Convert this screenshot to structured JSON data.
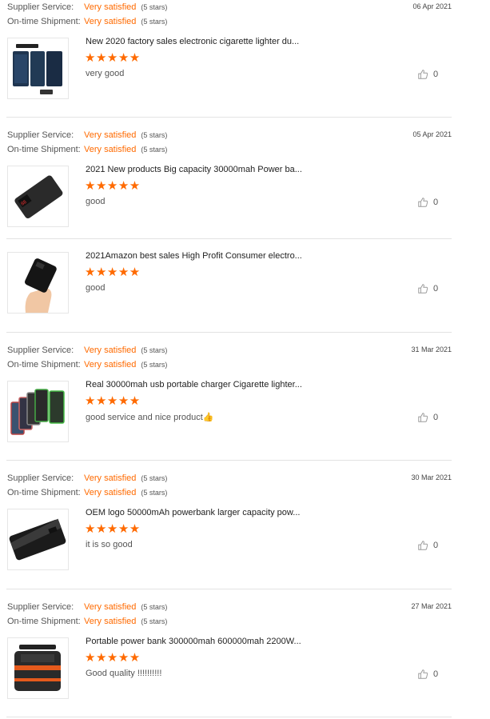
{
  "labels": {
    "supplier_service": "Supplier Service:",
    "on_time_shipment": "On-time Shipment:"
  },
  "reviews": [
    {
      "supplier_rating": "Very satisfied",
      "supplier_stars": "(5 stars)",
      "shipment_rating": "Very satisfied",
      "shipment_stars": "(5 stars)",
      "date": "06 Apr 2021",
      "items": [
        {
          "product": "New 2020 factory sales electronic cigarette lighter du...",
          "rating": 5,
          "comment": "very good",
          "likes": "0",
          "image_icon": "solar-power-bank-image"
        }
      ]
    },
    {
      "supplier_rating": "Very satisfied",
      "supplier_stars": "(5 stars)",
      "shipment_rating": "Very satisfied",
      "shipment_stars": "(5 stars)",
      "date": "05 Apr 2021",
      "items": [
        {
          "product": "2021 New products Big capacity 30000mah Power ba...",
          "rating": 5,
          "comment": "good",
          "likes": "0",
          "image_icon": "black-power-bank-image"
        },
        {
          "product": "2021Amazon best sales High Profit Consumer electro...",
          "rating": 5,
          "comment": "good",
          "likes": "0",
          "image_icon": "hand-held-power-bank-image"
        }
      ]
    },
    {
      "supplier_rating": "Very satisfied",
      "supplier_stars": "(5 stars)",
      "shipment_rating": "Very satisfied",
      "shipment_stars": "(5 stars)",
      "date": "31 Mar 2021",
      "items": [
        {
          "product": "Real 30000mah usb portable charger Cigarette lighter...",
          "rating": 5,
          "comment": "good service and nice product👍",
          "likes": "0",
          "image_icon": "colorful-power-banks-image"
        }
      ]
    },
    {
      "supplier_rating": "Very satisfied",
      "supplier_stars": "(5 stars)",
      "shipment_rating": "Very satisfied",
      "shipment_stars": "(5 stars)",
      "date": "30 Mar 2021",
      "items": [
        {
          "product": "OEM logo 50000mAh powerbank larger capacity pow...",
          "rating": 5,
          "comment": "it is so good",
          "likes": "0",
          "image_icon": "large-power-bank-image"
        }
      ]
    },
    {
      "supplier_rating": "Very satisfied",
      "supplier_stars": "(5 stars)",
      "shipment_rating": "Very satisfied",
      "shipment_stars": "(5 stars)",
      "date": "27 Mar 2021",
      "items": [
        {
          "product": "Portable power bank 300000mah 600000mah 2200W...",
          "rating": 5,
          "comment": "Good quality !!!!!!!!!!",
          "likes": "0",
          "image_icon": "portable-power-station-image"
        }
      ]
    }
  ],
  "colors": {
    "accent": "#ff6a00",
    "divider": "#e3e3e3"
  },
  "icons": {
    "like": "thumbs-up-icon",
    "star": "star-icon"
  }
}
